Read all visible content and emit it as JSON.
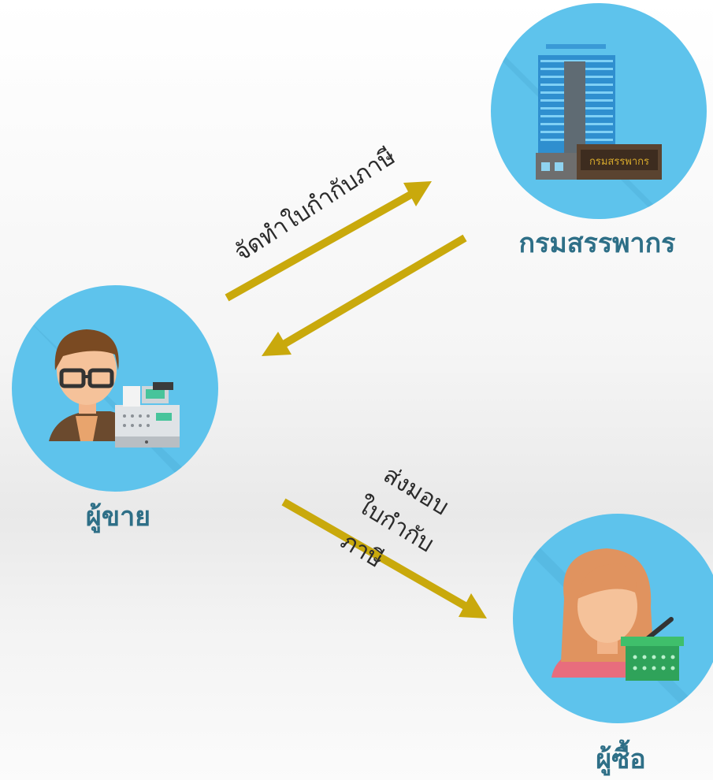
{
  "nodes": {
    "revenue_department": {
      "label": "กรมสรรพากร",
      "sign_text": "กรมสรรพากร"
    },
    "seller": {
      "label": "ผู้ขาย"
    },
    "buyer": {
      "label": "ผู้ซื้อ"
    }
  },
  "arrows": {
    "issue_tax_invoice": {
      "label": "จัดทำใบกำกับภาษี"
    },
    "return_to_seller": {
      "label": ""
    },
    "deliver_tax_invoice": {
      "label_lines": [
        "ส่งมอบ",
        "ใบกำกับ",
        "ภาษี"
      ]
    }
  },
  "colors": {
    "circle": "#5ec3ec",
    "arrow": "#c9a90c",
    "label": "#2e6f87"
  }
}
